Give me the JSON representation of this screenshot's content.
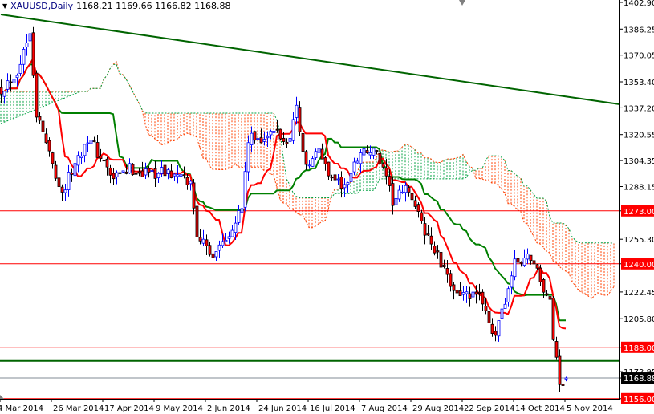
{
  "header": {
    "menu_icon": "triangle-down-icon",
    "symbol": "XAUUSD,Daily",
    "ohlc": "1168.21 1169.66 1166.82 1168.88"
  },
  "chart_data": {
    "type": "candlestick",
    "title": "XAUUSD,Daily",
    "indicators": [
      "Ichimoku Kinko Hyo (9,26,52)"
    ],
    "colors": {
      "bull_outline": "#0000ff",
      "bull_body": "#ffffff",
      "bear_outline": "#000000",
      "bear_body": "#ff0000",
      "tenkan": "#ff0000",
      "kijun": "#008000",
      "cloud_up": "#00a040",
      "cloud_down": "#ff4000",
      "level_red": "#ff0000",
      "level_green": "#006400",
      "current_price": "#808b96"
    },
    "close_waypoints": [
      [
        0,
        1349
      ],
      [
        5,
        1360
      ],
      [
        8,
        1379
      ],
      [
        9,
        1387
      ],
      [
        11,
        1334
      ],
      [
        15,
        1309
      ],
      [
        19,
        1284
      ],
      [
        22,
        1298
      ],
      [
        27,
        1319
      ],
      [
        31,
        1306
      ],
      [
        35,
        1292
      ],
      [
        40,
        1299
      ],
      [
        45,
        1297
      ],
      [
        52,
        1297
      ],
      [
        59,
        1290
      ],
      [
        61,
        1260
      ],
      [
        65,
        1245
      ],
      [
        70,
        1257
      ],
      [
        75,
        1275
      ],
      [
        77,
        1317
      ],
      [
        82,
        1319
      ],
      [
        86,
        1322
      ],
      [
        89,
        1314
      ],
      [
        92,
        1337
      ],
      [
        95,
        1299
      ],
      [
        99,
        1311
      ],
      [
        102,
        1297
      ],
      [
        107,
        1287
      ],
      [
        112,
        1311
      ],
      [
        117,
        1309
      ],
      [
        122,
        1279
      ],
      [
        127,
        1287
      ],
      [
        131,
        1264
      ],
      [
        135,
        1249
      ],
      [
        139,
        1230
      ],
      [
        144,
        1220
      ],
      [
        150,
        1218
      ],
      [
        154,
        1192
      ],
      [
        156,
        1210
      ],
      [
        160,
        1240
      ],
      [
        165,
        1245
      ],
      [
        168,
        1230
      ],
      [
        171,
        1215
      ],
      [
        172,
        1195
      ],
      [
        174,
        1165
      ],
      [
        176,
        1168.88
      ]
    ],
    "last_bar": {
      "open": 1168.21,
      "high": 1169.66,
      "low": 1166.82,
      "close": 1168.88
    },
    "bar_count": 177,
    "x_ticks": [
      {
        "bar": 0,
        "label": "4 Mar 2014"
      },
      {
        "bar": 16,
        "label": "26 Mar 2014"
      },
      {
        "bar": 32,
        "label": "17 Apr 2014"
      },
      {
        "bar": 48,
        "label": "9 May 2014"
      },
      {
        "bar": 64,
        "label": "2 Jun 2014"
      },
      {
        "bar": 80,
        "label": "24 Jun 2014"
      },
      {
        "bar": 96,
        "label": "16 Jul 2014"
      },
      {
        "bar": 112,
        "label": "7 Aug 2014"
      },
      {
        "bar": 128,
        "label": "29 Aug 2014"
      },
      {
        "bar": 144,
        "label": "22 Sep 2014"
      },
      {
        "bar": 160,
        "label": "14 Oct 2014"
      },
      {
        "bar": 176,
        "label": "5 Nov 2014"
      }
    ],
    "y_ticks": [
      "1402.90",
      "1386.25",
      "1370.05",
      "1353.40",
      "1337.20",
      "1320.55",
      "1304.35",
      "1288.15",
      "1255.30",
      "1222.45",
      "1205.80",
      "1172.95"
    ],
    "ylim": [
      1155,
      1404.4
    ],
    "levels_red": [
      "1273.00",
      "1240.00",
      "1188.00",
      "1156.00"
    ],
    "level_green": 1179.5,
    "current_price": "1168.88",
    "trendline": [
      [
        0,
        1395.4
      ],
      [
        192.75,
        1339.4
      ]
    ]
  }
}
